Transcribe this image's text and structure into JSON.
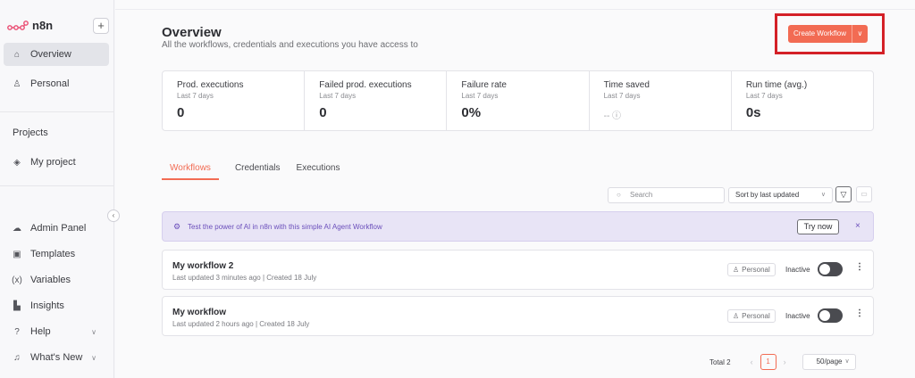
{
  "app": {
    "logo_text": "n8n",
    "add_label": "+"
  },
  "sidebar": {
    "top_items": [
      {
        "label": "Overview",
        "icon": "home-icon"
      },
      {
        "label": "Personal",
        "icon": "user-icon"
      }
    ],
    "projects_title": "Projects",
    "projects": [
      {
        "label": "My project",
        "icon": "layers-icon"
      }
    ],
    "bottom_items": [
      {
        "label": "Admin Panel",
        "icon": "cloud-icon"
      },
      {
        "label": "Templates",
        "icon": "box-icon"
      },
      {
        "label": "Variables",
        "icon": "variable-icon"
      },
      {
        "label": "Insights",
        "icon": "chart-icon"
      },
      {
        "label": "Help",
        "icon": "help-icon"
      },
      {
        "label": "What's New",
        "icon": "bell-icon"
      }
    ]
  },
  "header": {
    "title": "Overview",
    "subtitle": "All the workflows, credentials and executions you have access to",
    "create_button": "Create Workflow"
  },
  "stats": [
    {
      "label": "Prod. executions",
      "period": "Last 7 days",
      "value": "0"
    },
    {
      "label": "Failed prod. executions",
      "period": "Last 7 days",
      "value": "0"
    },
    {
      "label": "Failure rate",
      "period": "Last 7 days",
      "value": "0%"
    },
    {
      "label": "Time saved",
      "period": "Last 7 days",
      "value": "-- ⓘ"
    },
    {
      "label": "Run time (avg.)",
      "period": "Last 7 days",
      "value": "0s"
    }
  ],
  "tabs": [
    {
      "label": "Workflows",
      "active": true
    },
    {
      "label": "Credentials",
      "active": false
    },
    {
      "label": "Executions",
      "active": false
    }
  ],
  "toolbar": {
    "search_placeholder": "Search",
    "sort_value": "Sort by last updated"
  },
  "banner": {
    "text": "Test the power of AI in n8n with this simple AI Agent Workflow",
    "button": "Try now",
    "close": "×"
  },
  "workflows": [
    {
      "name": "My workflow 2",
      "meta": "Last updated 3 minutes ago | Created 18 July",
      "project": "Personal",
      "status": "Inactive"
    },
    {
      "name": "My workflow",
      "meta": "Last updated 2 hours ago | Created 18 July",
      "project": "Personal",
      "status": "Inactive"
    }
  ],
  "pagination": {
    "total": "Total 2",
    "current": "1",
    "page_size": "50/page"
  },
  "colors": {
    "accent": "#f26b53",
    "highlight_box": "#d42027",
    "banner_text": "#6b4fbb"
  }
}
